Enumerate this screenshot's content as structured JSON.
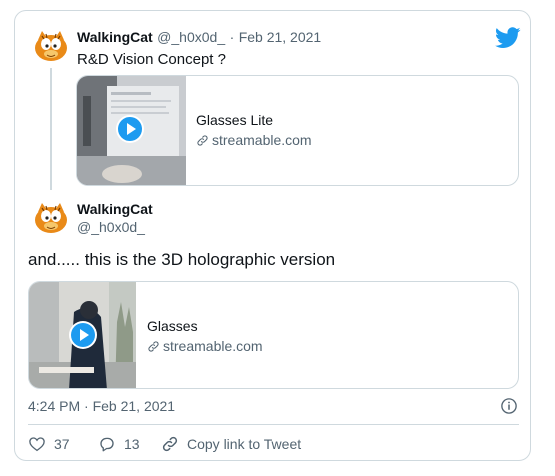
{
  "tweet1": {
    "display_name": "WalkingCat",
    "handle": "@_h0x0d_",
    "separator": "·",
    "date": "Feb 21, 2021",
    "text": "R&D Vision Concept ?",
    "link_card": {
      "title": "Glasses Lite",
      "domain": "streamable.com"
    }
  },
  "tweet2": {
    "display_name": "WalkingCat",
    "handle": "@_h0x0d_",
    "text": "and..... this is the 3D holographic version",
    "link_card": {
      "title": "Glasses",
      "domain": "streamable.com"
    },
    "timestamp": "4:24 PM · Feb 21, 2021"
  },
  "actions": {
    "likes": "37",
    "replies": "13",
    "copy_link_label": "Copy link to Tweet"
  },
  "icons": {
    "brand": "twitter-bird-icon",
    "info": "info-icon",
    "like": "heart-icon",
    "reply": "reply-icon",
    "link": "link-icon",
    "play": "play-icon"
  },
  "colors": {
    "accent": "#1d9bf0",
    "text": "#0f1419",
    "muted": "#536471",
    "border": "#cfd9de"
  }
}
